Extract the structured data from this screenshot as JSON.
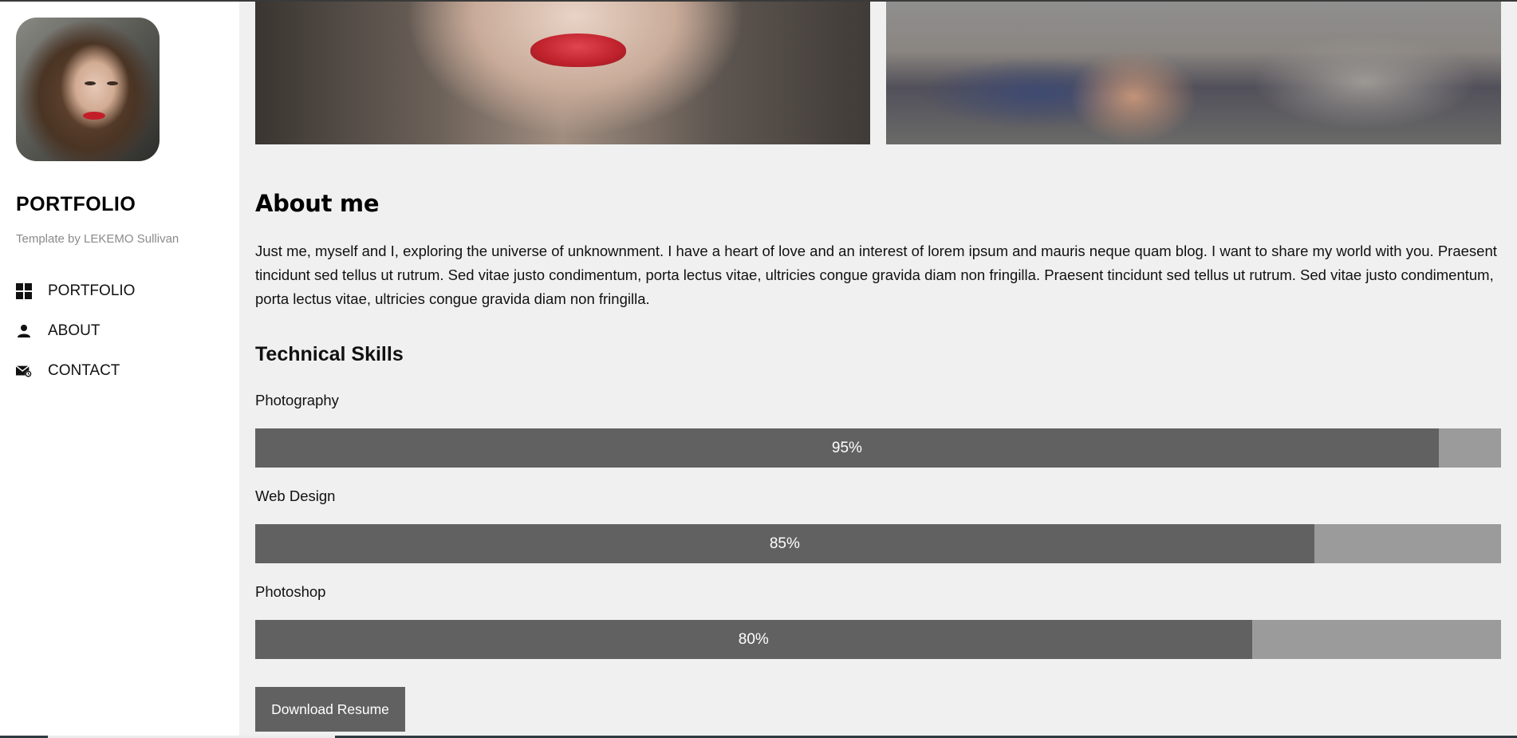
{
  "sidebar": {
    "brand": "PORTFOLIO",
    "byline": "Template by LEKEMO Sullivan",
    "nav": [
      {
        "label": "PORTFOLIO",
        "icon": "grid-icon"
      },
      {
        "label": "ABOUT",
        "icon": "person-icon"
      },
      {
        "label": "CONTACT",
        "icon": "mail-icon"
      }
    ]
  },
  "about": {
    "title": "About me",
    "text": "Just me, myself and I, exploring the universe of unknownment. I have a heart of love and an interest of lorem ipsum and mauris neque quam blog. I want to share my world with you. Praesent tincidunt sed tellus ut rutrum. Sed vitae justo condimentum, porta lectus vitae, ultricies congue gravida diam non fringilla. Praesent tincidunt sed tellus ut rutrum. Sed vitae justo condimentum, porta lectus vitae, ultricies congue gravida diam non fringilla."
  },
  "skills": {
    "title": "Technical Skills",
    "items": [
      {
        "label": "Photography",
        "value": 95,
        "text": "95%"
      },
      {
        "label": "Web Design",
        "value": 85,
        "text": "85%"
      },
      {
        "label": "Photoshop",
        "value": 80,
        "text": "80%"
      }
    ]
  },
  "download_label": "Download Resume",
  "colors": {
    "bar_fill": "#616161",
    "bar_track": "#9b9b9b",
    "page_bg": "#f0f0f0",
    "sidebar_bg": "#ffffff"
  }
}
